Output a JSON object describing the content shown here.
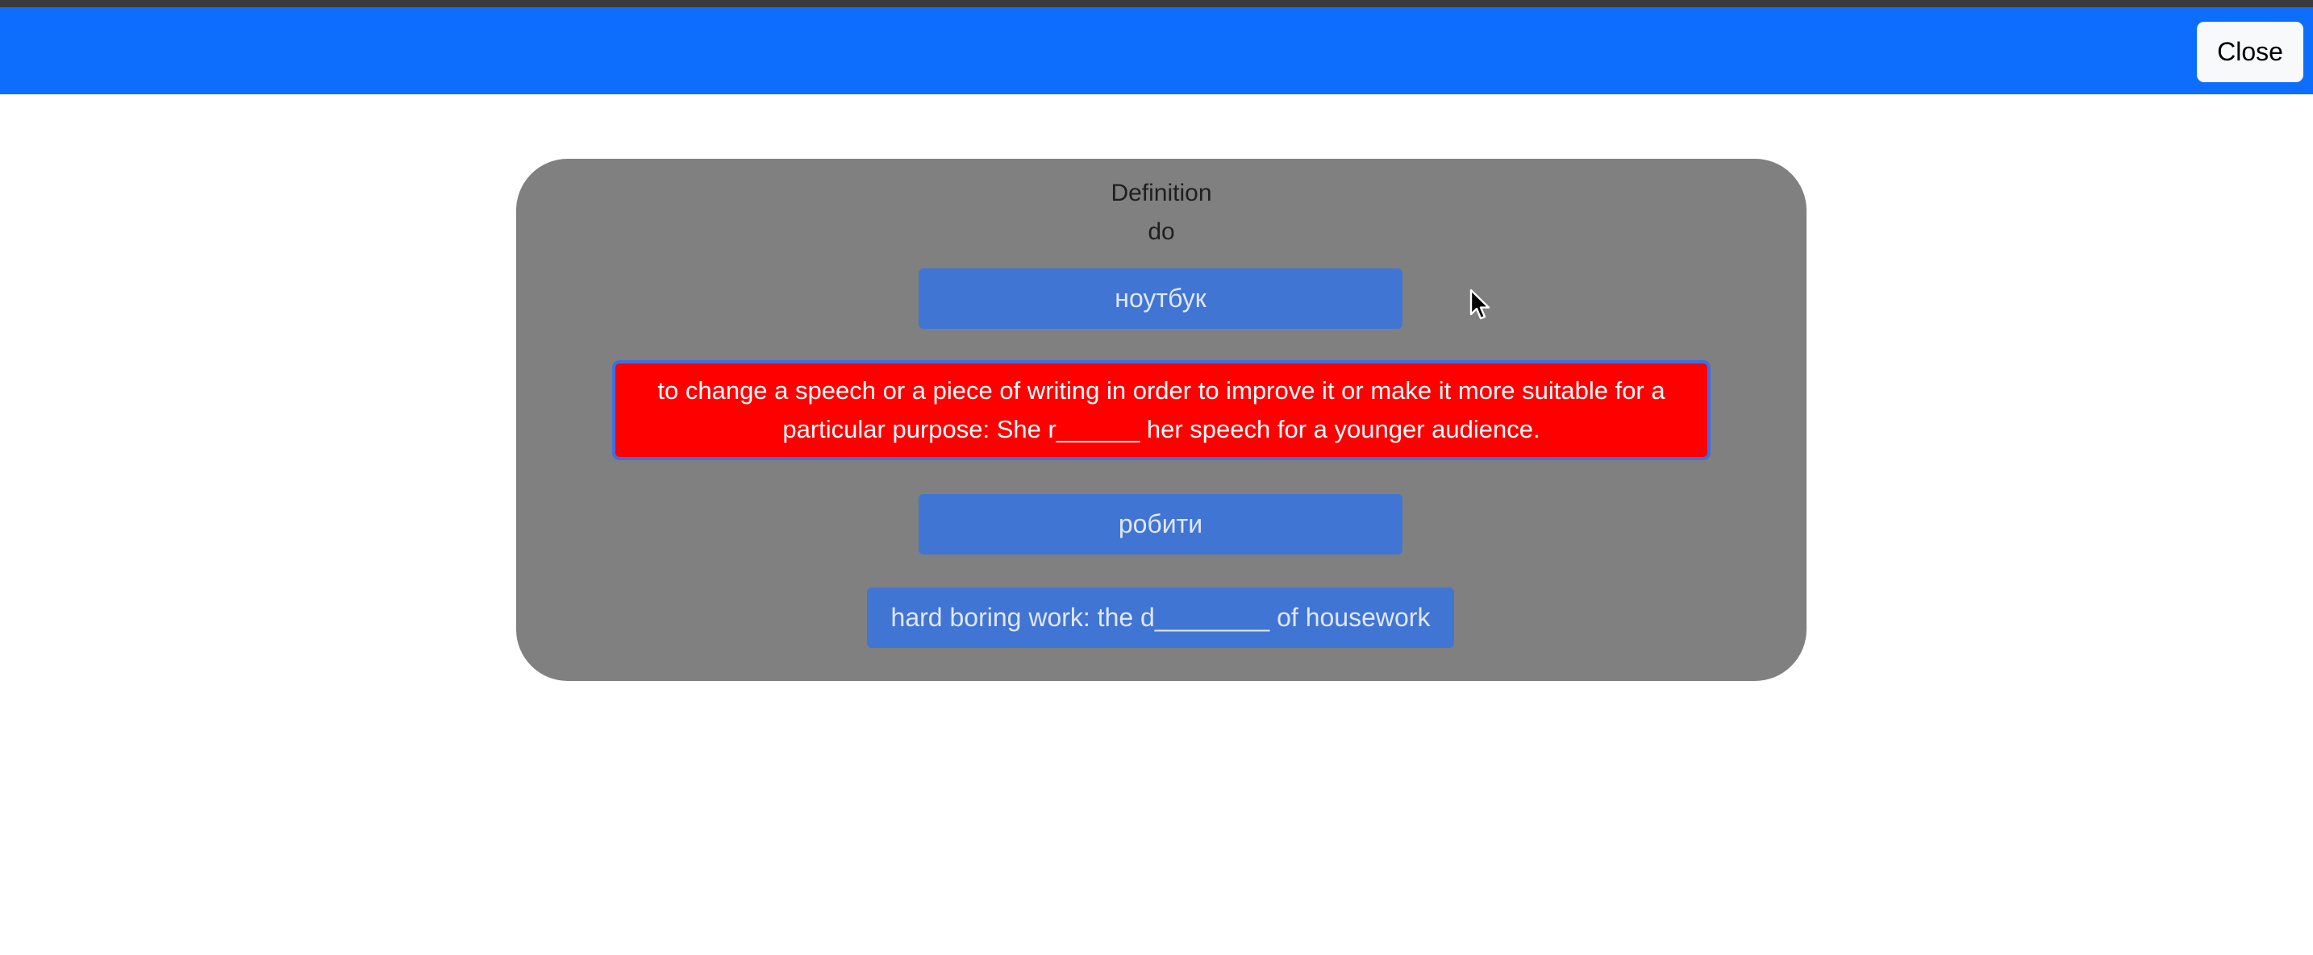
{
  "header": {
    "close_label": "Close",
    "bar_color": "#0d6efd"
  },
  "card": {
    "type_label": "Definition",
    "word": "do",
    "options": [
      {
        "label": "ноутбук",
        "state": "default"
      },
      {
        "label": "to change a speech or a piece of writing in order to improve it or make it more suitable for a particular purpose: She r______ her speech for a younger audience.",
        "state": "wrong"
      },
      {
        "label": "робити",
        "state": "default"
      },
      {
        "label": "hard boring work: the d________ of housework",
        "state": "default"
      }
    ]
  },
  "colors": {
    "card_bg": "#808080",
    "option_bg": "#4175d4",
    "wrong_bg": "#ff0000"
  },
  "icons": {
    "cursor": "mouse-pointer-icon"
  }
}
